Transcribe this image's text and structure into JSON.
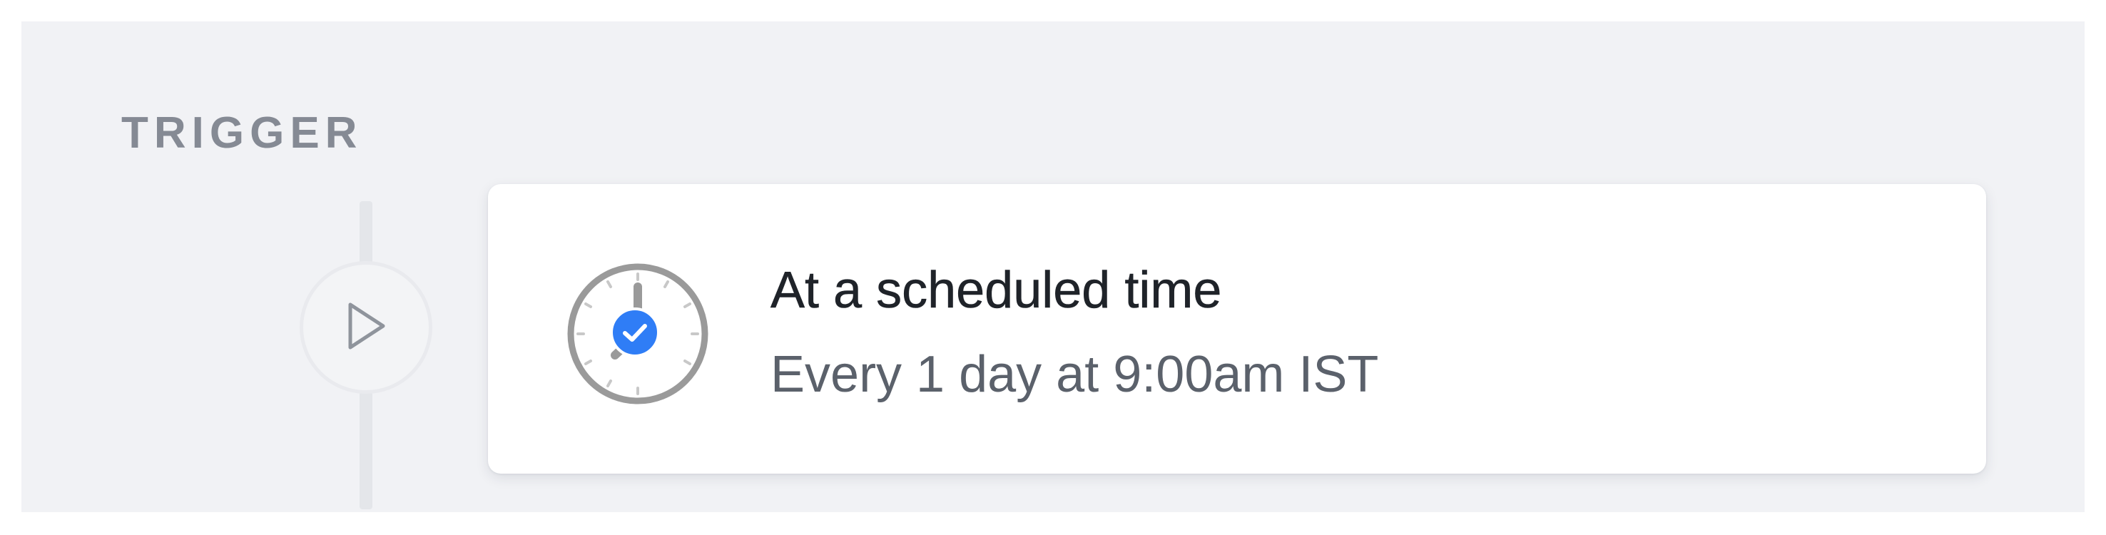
{
  "section": {
    "label": "TRIGGER"
  },
  "trigger_card": {
    "title": "At a scheduled time",
    "subtitle": "Every 1 day at 9:00am IST",
    "icon": "clock-icon",
    "badge_icon": "check-circle-icon"
  },
  "node": {
    "icon": "play-icon"
  },
  "colors": {
    "panel_background": "#f1f2f5",
    "label": "#858a94",
    "title": "#1f2329",
    "subtitle": "#5b616b",
    "clock_stroke": "#9a9a9a",
    "badge": "#2f7df6",
    "play_icon": "#8f949c"
  }
}
